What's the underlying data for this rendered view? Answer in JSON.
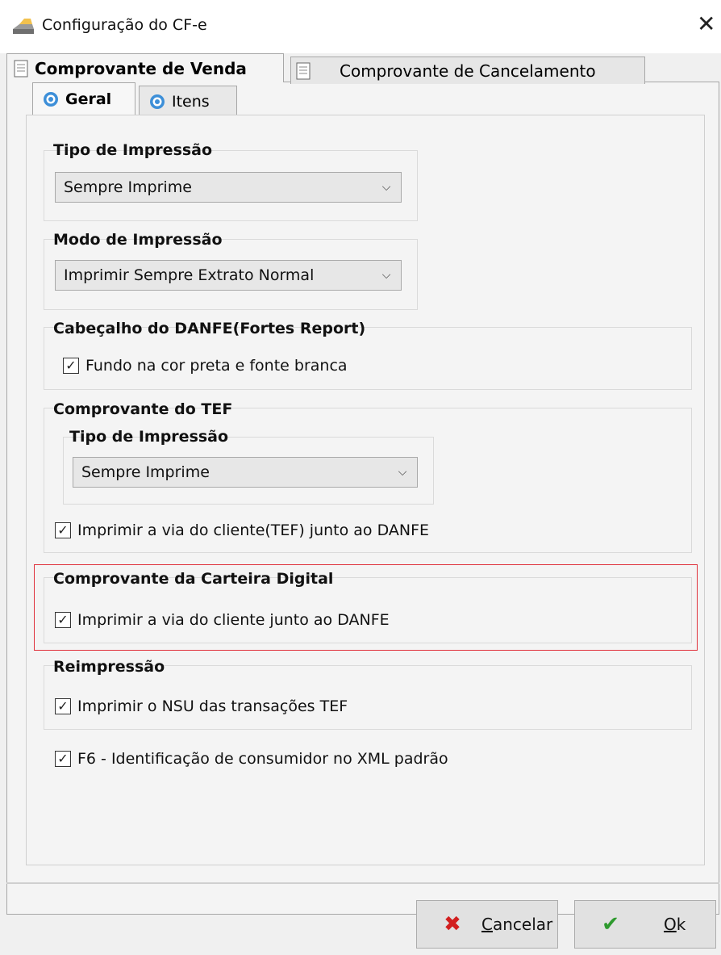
{
  "window": {
    "title": "Configuração do CF-e",
    "close_glyph": "✕",
    "app_icon": "printer-icon"
  },
  "tabs": [
    {
      "label": "Comprovante de Venda",
      "icon": "document-icon",
      "active": true
    },
    {
      "label": "Comprovante de Cancelamento",
      "icon": "document-icon",
      "active": false
    }
  ],
  "subtabs": [
    {
      "label": "Geral",
      "icon": "gear-icon",
      "active": true
    },
    {
      "label": "Itens",
      "icon": "gear-icon",
      "active": false
    }
  ],
  "groups": {
    "tipo_impressao": {
      "title": "Tipo de Impressão",
      "value": "Sempre Imprime"
    },
    "modo_impressao": {
      "title": "Modo de Impressão",
      "value": "Imprimir Sempre Extrato Normal"
    },
    "cabecalho": {
      "title": "Cabeçalho do DANFE(Fortes Report)",
      "checkbox": {
        "label": "Fundo na cor preta e fonte branca",
        "checked": true
      }
    },
    "tef": {
      "title": "Comprovante do TEF",
      "sub_title": "Tipo de Impressão",
      "value": "Sempre Imprime",
      "checkbox": {
        "label": "Imprimir a via do cliente(TEF) junto ao DANFE",
        "checked": true
      }
    },
    "carteira": {
      "title": "Comprovante da Carteira Digital",
      "checkbox": {
        "label": "Imprimir a via do cliente junto ao DANFE",
        "checked": true
      },
      "highlight_color": "#e0323c"
    },
    "reimpressao": {
      "title": "Reimpressão",
      "checkbox": {
        "label": "Imprimir o NSU das transações TEF",
        "checked": true
      }
    }
  },
  "f6_checkbox": {
    "label": "F6 - Identificação de consumidor no XML padrão",
    "checked": true
  },
  "buttons": {
    "cancel": {
      "label": "Cancelar",
      "mnemonic": "C",
      "rest": "ancelar",
      "icon": "x-icon",
      "color": "#d21f1f"
    },
    "ok": {
      "label": "Ok",
      "mnemonic": "O",
      "rest": "k",
      "icon": "check-icon",
      "color": "#2e9a2e"
    }
  },
  "check_glyph": "✓",
  "chevron_glyph": "⌵"
}
